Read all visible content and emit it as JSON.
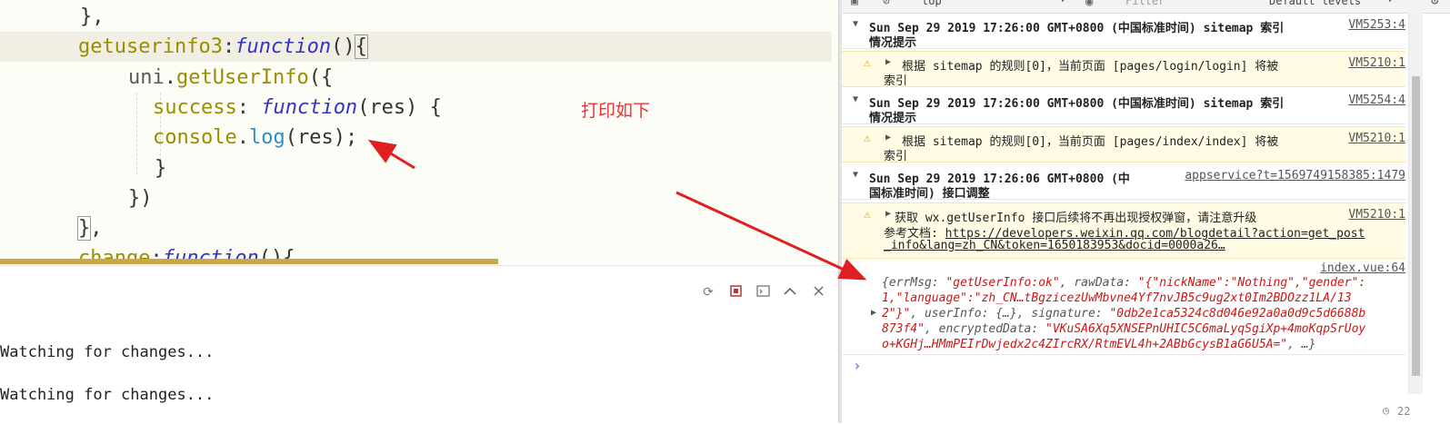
{
  "editor": {
    "lines": {
      "l1": "},",
      "l2_name": "getuserinfo3",
      "l2_colon": ":",
      "l2_kw": "function",
      "l2_paren": "()",
      "l2_brace": "{",
      "l3_obj": "uni",
      "l3_dot": ".",
      "l3_method": "getUserInfo",
      "l3_rest": "({",
      "l4_key": "success",
      "l4_colon": ": ",
      "l4_kw": "function",
      "l4_rest": "(res) {",
      "l5_fn": "console",
      "l5_dot": ".",
      "l5_m": "log",
      "l5_rest": "(res);",
      "l6": "}",
      "l7": "})",
      "l8_brace": "}",
      "l8_rest": ",",
      "l9_name": "change",
      "l9_colon": ":",
      "l9_kw": "function",
      "l9_rest": "(){"
    },
    "annotation": "打印如下"
  },
  "terminal": {
    "output": [
      "Watching for changes...",
      "Watching for changes..."
    ]
  },
  "console": {
    "toolbar": {
      "context": "top",
      "filter_placeholder": "Filter",
      "levels": "Default levels"
    },
    "rows": [
      {
        "text": "Sun Sep 29 2019 17:26:00 GMT+0800 (中国标准时间) sitemap 索引",
        "text2": "情况提示",
        "source": "VM5253:4"
      },
      {
        "text": "根据 sitemap 的规则[0]，当前页面 [pages/login/login] 将被",
        "text2": "索引",
        "source": "VM5210:1"
      },
      {
        "text": "Sun Sep 29 2019 17:26:00 GMT+0800 (中国标准时间) sitemap 索引",
        "text2": "情况提示",
        "source": "VM5254:4"
      },
      {
        "text": "根据 sitemap 的规则[0]，当前页面 [pages/index/index] 将被",
        "text2": "索引",
        "source": "VM5210:1"
      },
      {
        "text": "Sun Sep 29 2019 17:26:06 GMT+0800 (中",
        "text2": "国标准时间) 接口调整",
        "source": "appservice?t=1569749158385:1479"
      },
      {
        "text": "获取 wx.getUserInfo 接口后续将不再出现授权弹窗，请注意升级",
        "text2_label": "参考文档: ",
        "link1": "https://developers.weixin.qq.com/blogdetail?action=get_post",
        "link2": "_info&lang=zh_CN&token=1650183953&docid=0000a26…",
        "source": "VM5210:1"
      }
    ],
    "log": {
      "source": "index.vue:64",
      "line1_a": "{errMsg: ",
      "line1_b": "\"getUserInfo:ok\"",
      "line1_c": ", rawData: ",
      "line1_d": "\"{\"nickName\":\"Nothing\",\"gender\":",
      "line2": "1,\"language\":\"zh_CN…tBgzicezUwMbvne4Yf7nvJB5c9ug2xt0Im2BDOzz1LA/13",
      "line3_a": "2\"}\"",
      "line3_b": ", userInfo: {…}, signature: ",
      "line3_c": "\"0db2e1ca5324c8d046e92a0a0d9c5d6688b",
      "line4_a": "873f4\"",
      "line4_b": ", encryptedData: ",
      "line4_c": "\"VKuSA6Xq5XNSEPnUHIC5C6maLyqSgiXp+4moKqpSrUoy",
      "line5_a": "o+KGHj…HMmPEIrDwjedx2c4ZIrcRX/RtmEVL4h+2ABbGcysB1aG6U5A=\"",
      "line5_b": ", …}"
    },
    "prompt": "›",
    "footer_count": "22"
  },
  "colors": {
    "annotation": "#e33333",
    "arrow": "#e02020",
    "string": "#c41a16",
    "keyword": "#3434c8",
    "function_name": "#9a8d00",
    "method": "#2f8ed0"
  }
}
